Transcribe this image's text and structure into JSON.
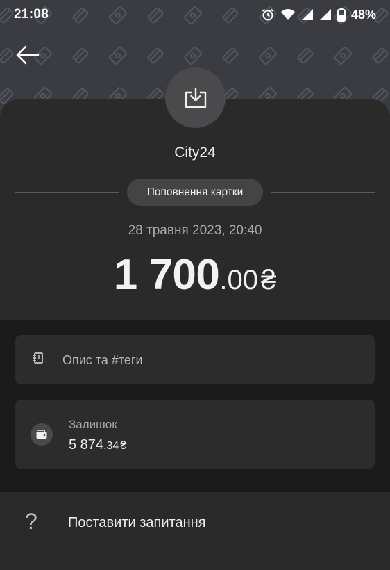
{
  "status_bar": {
    "time": "21:08",
    "battery": "48%",
    "icons": [
      "alarm-icon",
      "wifi-icon",
      "signal-icon",
      "signal-icon",
      "battery-icon"
    ]
  },
  "header": {
    "back_icon": "arrow-left-icon",
    "pattern_icons": [
      "card-icon",
      "money-icon"
    ]
  },
  "transaction": {
    "type_icon": "inbox-download-icon",
    "merchant": "City24",
    "category": "Поповнення картки",
    "datetime": "28 травня 2023, 20:40",
    "amount_int": "1 700",
    "amount_dec": ".00",
    "currency": "₴"
  },
  "description": {
    "icon": "notebook-icon",
    "label": "Опис та #теги"
  },
  "balance": {
    "icon": "wallet-icon",
    "label": "Залишок",
    "value_int": "5 874",
    "value_dec": ".34",
    "currency": "₴"
  },
  "actions": {
    "ask": {
      "icon": "question-icon",
      "icon_glyph": "?",
      "label": "Поставити запитання"
    }
  },
  "colors": {
    "background": "#1b1b1b",
    "header": "#3a3c42",
    "sheet": "#2a2a2b",
    "card": "#2c2c2d",
    "chip": "#444446"
  }
}
